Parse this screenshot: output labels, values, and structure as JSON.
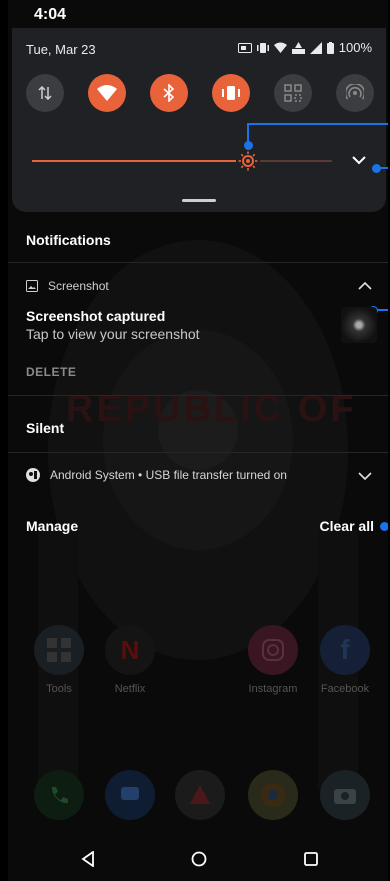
{
  "status_bar": {
    "time": "4:04",
    "battery": "100%"
  },
  "quick_settings": {
    "date": "Tue, Mar 23",
    "brightness_level": 0.72,
    "tiles": [
      {
        "name": "mobile-data",
        "state": "off"
      },
      {
        "name": "wifi",
        "state": "on"
      },
      {
        "name": "bluetooth",
        "state": "on"
      },
      {
        "name": "vibrate",
        "state": "on"
      },
      {
        "name": "qr-scan",
        "state": "off"
      },
      {
        "name": "hotspot",
        "state": "off"
      }
    ]
  },
  "notifications": {
    "header": "Notifications",
    "screenshot_card": {
      "app": "Screenshot",
      "title": "Screenshot captured",
      "text": "Tap to view your screenshot",
      "action": "DELETE"
    },
    "silent_header": "Silent",
    "system_row": "Android System • USB file transfer turned on",
    "manage": "Manage",
    "clear_all": "Clear all"
  },
  "background": {
    "watermark": "REPUBLIC OF",
    "apps": [
      "Tools",
      "Netflix",
      "Instagram",
      "Facebook"
    ]
  },
  "colors": {
    "accent": "#e8623a",
    "annotation": "#1a73e8",
    "panel": "#202124"
  }
}
